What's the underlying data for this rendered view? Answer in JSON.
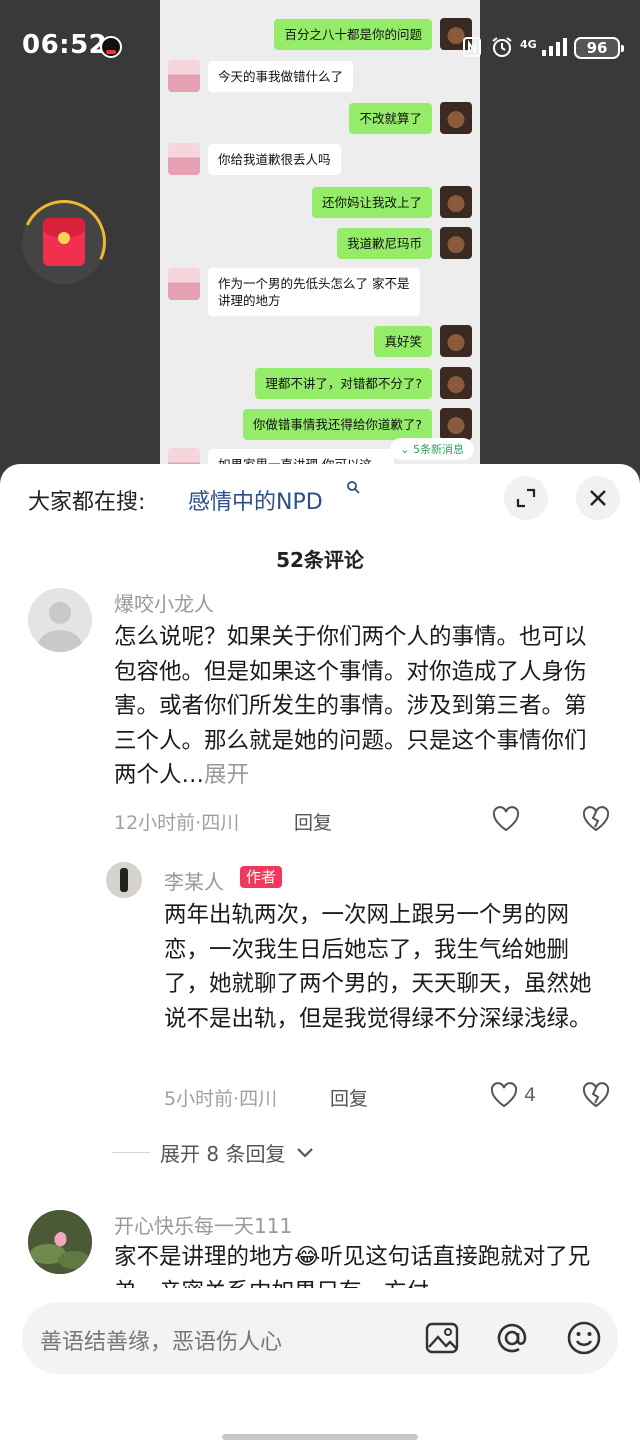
{
  "status_bar": {
    "time": "06:52",
    "network": "4G",
    "battery": "96"
  },
  "chat_screenshot": {
    "messages": [
      {
        "side": "right",
        "text": "百分之八十都是你的问题"
      },
      {
        "side": "left",
        "text": "今天的事我做错什么了"
      },
      {
        "side": "right",
        "text": "不改就算了"
      },
      {
        "side": "left",
        "text": "你给我道歉很丢人吗"
      },
      {
        "side": "right",
        "text": "还你妈让我改上了"
      },
      {
        "side": "right",
        "text": "我道歉尼玛币"
      },
      {
        "side": "left",
        "text": "作为一个男的先低头怎么了 家不是讲理的地方"
      },
      {
        "side": "right",
        "text": "真好笑"
      },
      {
        "side": "right",
        "text": "理都不讲了，对错都不分了?"
      },
      {
        "side": "right",
        "text": "你做错事情我还得给你道歉了?"
      },
      {
        "side": "left",
        "text": "如果家里一直讲理 你可以这..."
      }
    ],
    "new_messages": "5条新消息"
  },
  "search": {
    "label": "大家都在搜:",
    "term": "感情中的NPD"
  },
  "comments_header": "52条评论",
  "comments": [
    {
      "username": "爆咬小龙人",
      "text": "怎么说呢？如果关于你们两个人的事情。也可以包容他。但是如果这个事情。对你造成了人身伤害。或者你们所发生的事情。涉及到第三者。第三个人。那么就是她的问题。只是这个事情你们两个人…",
      "expand": "展开",
      "meta": "12小时前·四川",
      "reply": "回复",
      "likes": ""
    },
    {
      "username": "李某人",
      "badge": "作者",
      "text": "两年出轨两次，一次网上跟另一个男的网恋，一次我生日后她忘了，我生气给她删了，她就聊了两个男的，天天聊天，虽然她说不是出轨，但是我觉得绿不分深绿浅绿。",
      "meta": "5小时前·四川",
      "reply": "回复",
      "likes": "4"
    },
    {
      "username": "开心快乐每一天111",
      "text": "家不是讲理的地方😂听见这句话直接跑就对了兄弟，亲密关系中如果只有一方付..."
    }
  ],
  "expand_replies": "展开 8 条回复",
  "input": {
    "placeholder": "善语结善缘，恶语伤人心"
  }
}
